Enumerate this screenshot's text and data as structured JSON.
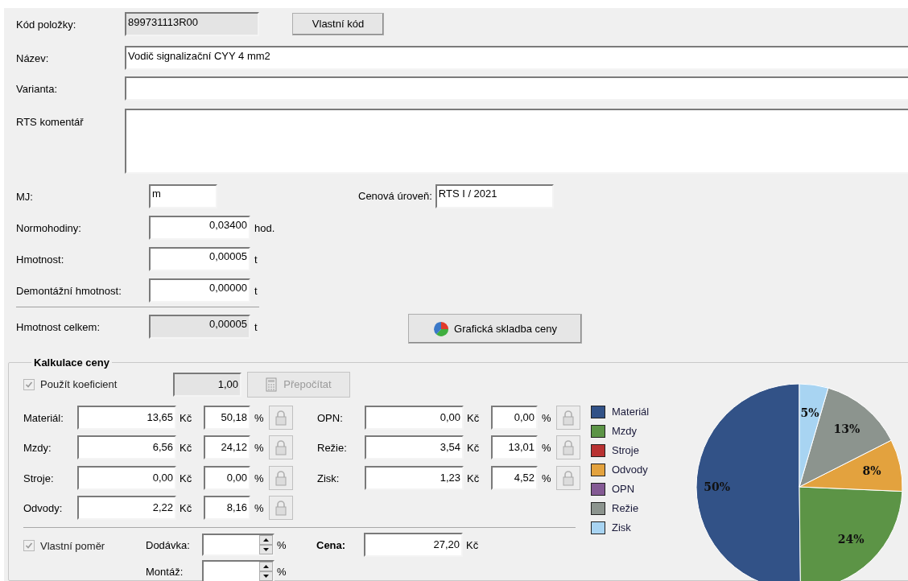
{
  "header": {
    "code": {
      "label": "Kód položky:",
      "value": "899731113R00",
      "disabled": true
    },
    "custom_code_button": "Vlastní kód",
    "name": {
      "label": "Název:",
      "value": "Vodič signalizační CYY 4 mm2"
    },
    "variant": {
      "label": "Varianta:"
    },
    "comment": {
      "label": "RTS komentář"
    }
  },
  "unit_field": {
    "label": "MJ:",
    "value": "m"
  },
  "price_level": {
    "label": "Cenová úroveň:",
    "value": "RTS I / 2021"
  },
  "quantities": [
    {
      "label": "Normohodiny:",
      "value": "0,03400",
      "unit": "hod.",
      "disabled": false
    },
    {
      "label": "Hmotnost:",
      "value": "0,00005",
      "unit": "t",
      "disabled": false
    },
    {
      "label": "Demontážní hmotnost:",
      "value": "0,00000",
      "unit": "t",
      "disabled": false
    },
    {
      "label": "Hmotnost celkem:",
      "value": "0,00005",
      "unit": "t",
      "disabled": true
    }
  ],
  "chart_button": "Grafická skladba ceny",
  "calculation": {
    "title": "Kalkulace ceny",
    "coefficient": {
      "label": "Použít koeficient",
      "checked": true,
      "disabled": true,
      "value": "1,00"
    },
    "recalc_button": {
      "label": "Přepočítat",
      "disabled": true
    },
    "left_rows": [
      {
        "label": "Materiál:",
        "amount": "13,65",
        "currency": "Kč",
        "percent": "50,18",
        "percent_unit": "%"
      },
      {
        "label": "Mzdy:",
        "amount": "6,56",
        "currency": "Kč",
        "percent": "24,12",
        "percent_unit": "%"
      },
      {
        "label": "Stroje:",
        "amount": "0,00",
        "currency": "Kč",
        "percent": "0,00",
        "percent_unit": "%"
      },
      {
        "label": "Odvody:",
        "amount": "2,22",
        "currency": "Kč",
        "percent": "8,16",
        "percent_unit": "%"
      }
    ],
    "right_rows": [
      {
        "label": "OPN:",
        "amount": "0,00",
        "currency": "Kč",
        "percent": "0,00",
        "percent_unit": "%"
      },
      {
        "label": "Režie:",
        "amount": "3,54",
        "currency": "Kč",
        "percent": "13,01",
        "percent_unit": "%"
      },
      {
        "label": "Zisk:",
        "amount": "1,23",
        "currency": "Kč",
        "percent": "4,52",
        "percent_unit": "%"
      }
    ],
    "own_ratio": {
      "label": "Vlastní poměr",
      "checked": true,
      "disabled": true
    },
    "spins": [
      {
        "label": "Dodávka:",
        "unit": "%"
      },
      {
        "label": "Montáž:",
        "unit": "%"
      }
    ],
    "total": {
      "label": "Cena:",
      "value": "27,20",
      "currency": "Kč"
    },
    "chart_data": {
      "type": "pie",
      "categories": [
        "Materiál",
        "Mzdy",
        "Stroje",
        "Odvody",
        "OPN",
        "Režie",
        "Zisk"
      ],
      "values": [
        50.18,
        24.12,
        0,
        8.16,
        0,
        13.01,
        4.52
      ],
      "colors": [
        "#325287",
        "#5c9446",
        "#b83232",
        "#e3a23e",
        "#845a94",
        "#8c948e",
        "#a8d4f2"
      ],
      "value_labels": [
        "50%",
        "24%",
        null,
        "8%",
        null,
        "13%",
        "5%"
      ]
    }
  }
}
